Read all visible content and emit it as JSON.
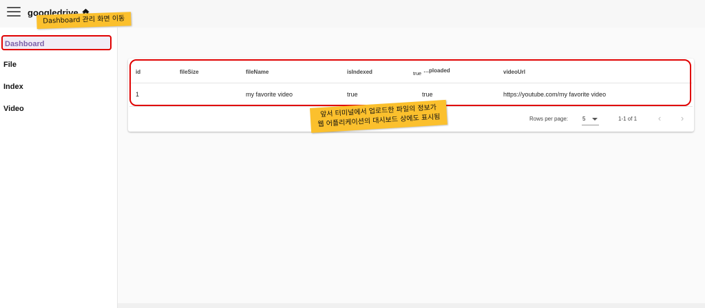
{
  "header": {
    "app_title": "googledrive",
    "home_icon": "home-icon",
    "menu_icon": "menu-icon"
  },
  "sidebar": {
    "items": [
      {
        "label": "Dashboard",
        "active": true
      },
      {
        "label": "File"
      },
      {
        "label": "Index"
      },
      {
        "label": "Video"
      }
    ]
  },
  "table": {
    "columns": [
      "id",
      "fileSize",
      "fileName",
      "isIndexed",
      "isUploaded",
      "videoUrl"
    ],
    "visible_columns": [
      "id",
      "fileSize",
      "fileName",
      "isIndexed",
      "…ploaded",
      "videoUrl"
    ],
    "overlap_value": "true",
    "rows": [
      {
        "id": "1",
        "fileSize": "",
        "fileName": "my favorite video",
        "isIndexed": "true",
        "isUploaded": "true",
        "videoUrl": "https://youtube.com/my favorite video"
      }
    ]
  },
  "pagination": {
    "rows_per_page_label": "Rows per page:",
    "rows_per_page_value": "5",
    "range_text": "1-1 of 1",
    "prev_icon": "chevron-left-icon",
    "next_icon": "chevron-right-icon"
  },
  "annotations": {
    "callout_dashboard": "Dashboard 관리 화면 이동",
    "callout_table_line1": "앞서 터미널에서 업로드한 파일의 정보가",
    "callout_table_line2": "웹 어플리케이션의 대시보드 상에도 표시됨"
  },
  "colors": {
    "accent": "#7b5fa8",
    "highlight": "#e00000",
    "callout": "#fbc02d"
  }
}
